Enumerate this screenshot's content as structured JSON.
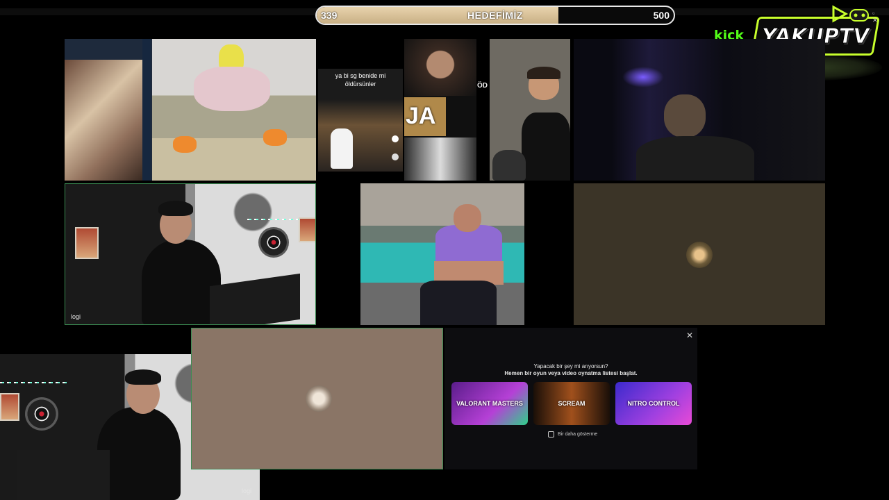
{
  "goal": {
    "current": "339",
    "title": "HEDEFİMİZ",
    "max": "500",
    "progress_fraction": 0.678
  },
  "branding": {
    "platform": "kick",
    "channel": "YAKUPTV",
    "accent_color": "#c8ff2c",
    "platform_color": "#53fc18"
  },
  "window_controls": "▫ ✕",
  "tiles": {
    "cam_logi_1": {
      "label": "logi"
    },
    "cam_logi_2": {
      "label": "logi"
    }
  },
  "tiktok": {
    "caption_line1": "ya bi sg benide mi",
    "caption_line2": "öldürsünler"
  },
  "meme": {
    "ja_text": "JA",
    "od_text": "ÖD"
  },
  "activity_panel": {
    "title": "Yapacak bir şey mi arıyorsun?",
    "subtitle": "Hemen bir oyun veya video oynatma listesi başlat.",
    "close_icon": "✕",
    "cards": [
      {
        "label": "VALORANT MASTERS",
        "color": "#7a2fa8"
      },
      {
        "label": "SCREAM",
        "color": "#2a1a10"
      },
      {
        "label": "NITRO CONTROL",
        "color": "#4b2aa8"
      }
    ],
    "dont_show_label": "Bir daha gösterme",
    "dont_show_checked": false
  }
}
